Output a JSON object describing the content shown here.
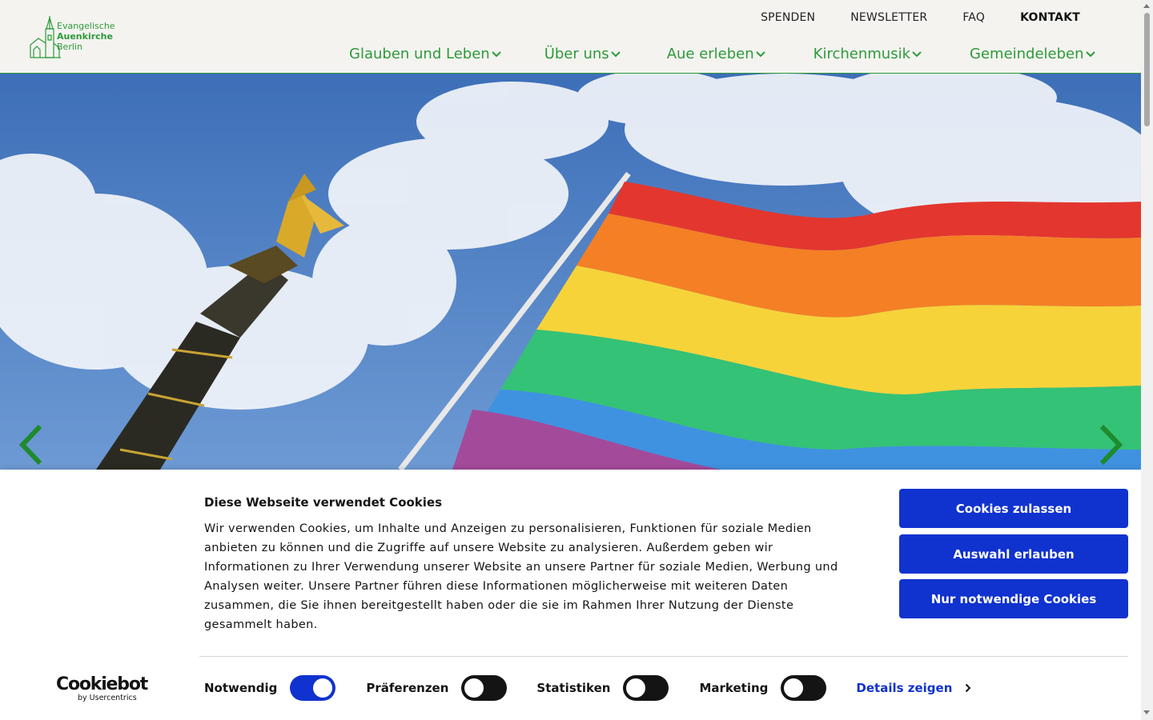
{
  "logo": {
    "line1": "Evangelische",
    "line2": "Auenkirche",
    "line3": "Berlin"
  },
  "topnav": {
    "items": [
      "SPENDEN",
      "NEWSLETTER",
      "FAQ",
      "KONTAKT"
    ]
  },
  "mainnav": {
    "items": [
      "Glauben und Leben",
      "Über uns",
      "Aue erleben",
      "Kirchenmusik",
      "Gemeindeleben"
    ]
  },
  "hero": {
    "icons": [
      "chevron-left-icon",
      "chevron-right-icon"
    ]
  },
  "cookie": {
    "title": "Diese Webseite verwendet Cookies",
    "body": "Wir verwenden Cookies, um Inhalte und Anzeigen zu personalisieren, Funktionen für soziale Medien anbieten zu können und die Zugriffe auf unsere Website zu analysieren. Außerdem geben wir Informationen zu Ihrer Verwendung unserer Website an unsere Partner für soziale Medien, Werbung und Analysen weiter. Unsere Partner führen diese Informationen möglicherweise mit weiteren Daten zusammen, die Sie ihnen bereitgestellt haben oder die sie im Rahmen Ihrer Nutzung der Dienste gesammelt haben.",
    "buttons": {
      "allow_all": "Cookies zulassen",
      "allow_selection": "Auswahl erlauben",
      "necessary_only": "Nur notwendige Cookies"
    },
    "brand_main": "Cookiebot",
    "brand_sub": "by Usercentrics",
    "toggles": [
      {
        "label": "Notwendig",
        "on": true
      },
      {
        "label": "Präferenzen",
        "on": false
      },
      {
        "label": "Statistiken",
        "on": false
      },
      {
        "label": "Marketing",
        "on": false
      }
    ],
    "details_label": "Details zeigen"
  },
  "colors": {
    "brand_green": "#2e9a3a",
    "cookie_blue": "#1032cf",
    "header_bg": "#f4f3f0"
  }
}
